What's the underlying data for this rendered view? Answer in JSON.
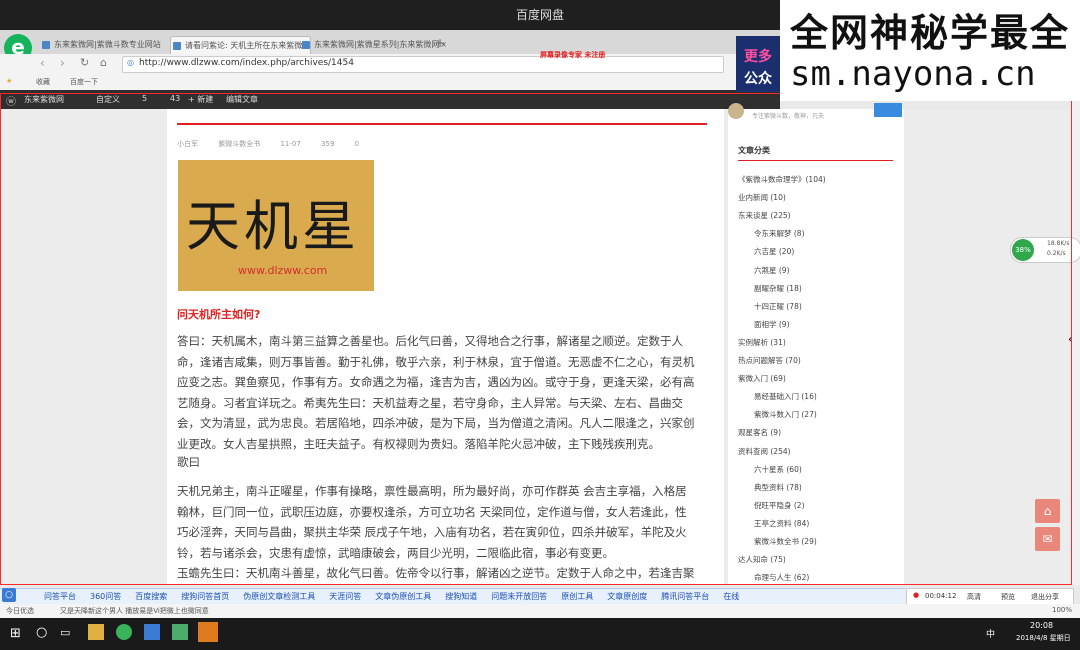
{
  "player": {
    "title": "百度网盘"
  },
  "watermark": {
    "line1": "全网神秘学最全",
    "line2": "sm.nayona.cn"
  },
  "browser": {
    "tabs": [
      {
        "label": "东来紫微网|紫微斗数专业网站"
      },
      {
        "label": "请看问紫论: 天机主所在东来紫微网"
      },
      {
        "label": "东来紫微网|紫微星系列|东来紫微网"
      }
    ],
    "new_tab": "+",
    "url": "http://www.dlzww.com/index.php/archives/1454",
    "promo": "屏幕录像专家  未注册",
    "bookmarks": [
      "收藏",
      "百度一下"
    ],
    "right_banner": {
      "l1": "更多",
      "l2": "公众"
    }
  },
  "adminbar": {
    "items": [
      "东来紫微网",
      "自定义",
      "5",
      "43",
      "+ 新建",
      "编辑文章"
    ]
  },
  "article": {
    "meta": [
      "小白军",
      "紫微斗数全书",
      "11-07",
      "359",
      "0"
    ],
    "image": {
      "text": "天机星",
      "url": "www.dlzww.com"
    },
    "question": "问天机所主如何?",
    "p1": "答曰：天机属木，南斗第三益算之善星也。后化气曰善，又得地合之行事，解诸星之顺逆。定数于人命，逢诸吉咸集，则万事皆善。勤于礼佛，敬乎六亲，利于林泉，宜于僧道。无恶虚不仁之心，有灵机应变之志。巽鱼察见，作事有方。女命遇之为福，逢吉为吉，遇凶为凶。或守于身，更逢天梁，必有高艺随身。习者宜详玩之。希夷先生曰：天机益寿之星，若守身命，主人异常。与天梁、左右、昌曲交会，文为清显，武为忠良。若居陷地，四杀冲破，是为下局，当为僧道之清闲。凡人二限逢之，兴家创业更改。女人吉星拱照，主旺夫益子。有权禄则为贵妇。落陷羊陀火忌冲破，主下贱残疾刑克。",
    "p2": "歌曰",
    "p3": "天机兄弟主，南斗正曜星，作事有操略，禀性最高明，所为最好尚，亦可作群英 会吉主享福，入格居翰林，巨门同一位，武职压边庭，亦要权逢杀，方可立功名 天梁同位，定作道与僧，女人若逢此，性巧必淫奔，天同与昌曲，聚拱主华荣 辰戌子午地，入庙有功名，若在寅卯位，四杀并破军，羊陀及火铃，若与诸杀会，灾患有虚惊，武暗康破会，两目少光明，二限临此宿，事必有变更。",
    "p4": "玉蟾先生曰：天机南斗善星，故化气曰善。佐帝令以行事，解诸凶之逆节。定数于人命之中，若逢吉聚则为富贵，若逢凶杀聚必好善，若以木言，数理天，天可转三下可山之生，青下凶和心水之上，青之命之事，各主..."
  },
  "sidebar": {
    "author_text": "专注紫微斗数，敬神，凡夫",
    "heading": "文章分类",
    "items": [
      {
        "label": "《紫微斗数命理学》(104)",
        "sub": false
      },
      {
        "label": "业内新闻 (10)",
        "sub": false
      },
      {
        "label": "东来谈星 (225)",
        "sub": false
      },
      {
        "label": "令东来解梦 (8)",
        "sub": true
      },
      {
        "label": "六吉星 (20)",
        "sub": true
      },
      {
        "label": "六煞星 (9)",
        "sub": true
      },
      {
        "label": "副曜杂曜 (18)",
        "sub": true
      },
      {
        "label": "十四正曜 (78)",
        "sub": true
      },
      {
        "label": "面相学 (9)",
        "sub": true
      },
      {
        "label": "实例解析 (31)",
        "sub": false
      },
      {
        "label": "热点问题解答 (70)",
        "sub": false
      },
      {
        "label": "紫微入门 (69)",
        "sub": false
      },
      {
        "label": "易经基础入门 (16)",
        "sub": true
      },
      {
        "label": "紫微斗数入门 (27)",
        "sub": true
      },
      {
        "label": "观星客名 (9)",
        "sub": false
      },
      {
        "label": "资料查阅 (254)",
        "sub": false
      },
      {
        "label": "六十星系 (60)",
        "sub": true
      },
      {
        "label": "典型资料 (78)",
        "sub": true
      },
      {
        "label": "倪旺平隐身 (2)",
        "sub": true
      },
      {
        "label": "王亭之资料 (84)",
        "sub": true
      },
      {
        "label": "紫微斗数全书 (29)",
        "sub": true
      },
      {
        "label": "达人知命 (75)",
        "sub": false
      },
      {
        "label": "命理与人生 (62)",
        "sub": true
      }
    ]
  },
  "floating": {
    "percent": "38%",
    "up": "18.8K/s",
    "down": "0.2K/s"
  },
  "linkbar": [
    "问答平台",
    "360问答",
    "百度搜索",
    "搜狗问答首页",
    "伪原创文章检测工具",
    "天涯问答",
    "文章伪原创工具",
    "搜狗知道",
    "问题未开放回答",
    "原创工具",
    "文章原创度",
    "腾讯问答平台",
    "在线"
  ],
  "recording": {
    "time": "00:04:12",
    "buttons": [
      "高清",
      "预览",
      "退出分享"
    ]
  },
  "status": {
    "left": "今日优选",
    "middle": "又是天降新这个男人 播放易是Vi把微上也微同意",
    "right": "100%"
  },
  "taskbar": {
    "time": "20:08",
    "date": "2018/4/8 星期日",
    "lang": "中"
  }
}
